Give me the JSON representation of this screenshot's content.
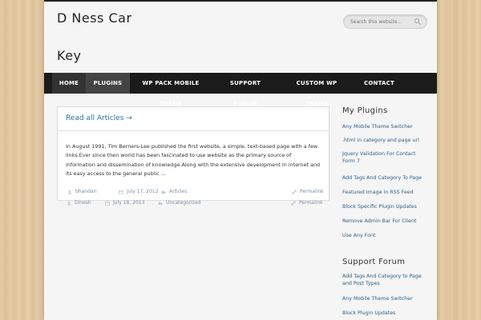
{
  "site": {
    "title_line1": "D Ness Car",
    "title_line2": "Key"
  },
  "search": {
    "placeholder": "Search this website..."
  },
  "nav": {
    "items": [
      {
        "label": "HOME"
      },
      {
        "label": "PLUGINS"
      },
      {
        "label": "WP PACK MOBILE THEME"
      },
      {
        "label": "SUPPORT FORUM"
      },
      {
        "label": "CUSTOM WP THEME"
      },
      {
        "label": "CONTACT"
      }
    ]
  },
  "main": {
    "read_all": "Read all Articles →",
    "excerpt": "In August 1991, Tim Berners-Lee published the first website, a simple, text-based page with a few links.Ever since then world has been fascinated to use website as the primary source of information and dissemination of knowledge.Along with the extensive development in internet and its easy access to the general public ...",
    "posts_meta": [
      {
        "author": "bhandari",
        "date": "July 17, 2012",
        "category": "Articles",
        "permalink": "Permalink"
      },
      {
        "author": "Dinesh",
        "date": "July 18, 2013",
        "category": "Uncategorized",
        "permalink": "Permalink"
      }
    ]
  },
  "sidebar": {
    "plugins_title": "My Plugins",
    "plugins": [
      "Any Mobile Theme Switcher",
      ".html in category and page url",
      "Jquery Validation For Contact Form 7",
      "Add Tags And Category To Page",
      "Featured Image in RSS Feed",
      "Block Specific Plugin Updates",
      "Remove Admin Bar For Client",
      "Use Any Font"
    ],
    "forum_title": "Support Forum",
    "forum": [
      "Add Tags And Category to Page and Post Types",
      "Any Mobile Theme Switcher",
      "Block Plugin Updates"
    ]
  },
  "colors": {
    "link": "#2d6e9f",
    "nav_bg": "#1b1b1b",
    "active_nav": "#444444"
  }
}
